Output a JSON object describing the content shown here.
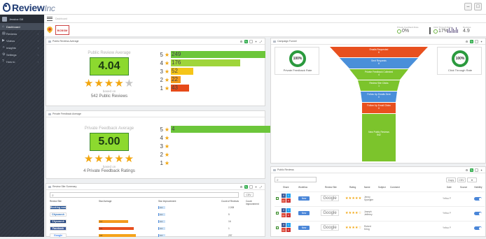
{
  "brand": {
    "name": "Review",
    "suffix": "Inc"
  },
  "sidebar": {
    "user": "Jessica Gill",
    "items": [
      {
        "label": "Dashboard",
        "icon": "home-icon",
        "active": true
      },
      {
        "label": "Reviews",
        "icon": "bar-chart-icon"
      },
      {
        "label": "Videos",
        "icon": "video-icon"
      },
      {
        "label": "Insights",
        "icon": "lightbulb-icon"
      },
      {
        "label": "Settings",
        "icon": "gear-icon"
      },
      {
        "label": "How to",
        "icon": "help-icon"
      }
    ]
  },
  "subbar": {
    "title": "Dashboard"
  },
  "business": {
    "logo_text": "BCBSM",
    "logo_sub": "insurance"
  },
  "kpis": [
    {
      "label": "Private Feedback Rate",
      "value": "0%"
    },
    {
      "label": "Click Through Rate",
      "value": "0%"
    },
    {
      "label": "Pixel Stats",
      "value": "17%"
    },
    {
      "label": "Reviews",
      "value": "4.9"
    }
  ],
  "public_reviews": {
    "panel_title": "Public Reviews Average",
    "heading": "Public Review Average",
    "average": "4.04",
    "stars": 4,
    "based_on": "based on",
    "count_text": "542 Public Reviews",
    "distribution": [
      {
        "star": "5",
        "count": "249",
        "fraction": 1.0,
        "color": "#6cc63a"
      },
      {
        "star": "4",
        "count": "176",
        "fraction": 0.73,
        "color": "#9fd53b"
      },
      {
        "star": "3",
        "count": "52",
        "fraction": 0.24,
        "color": "#f5c518"
      },
      {
        "star": "2",
        "count": "22",
        "fraction": 0.1,
        "color": "#f39a1e"
      },
      {
        "star": "1",
        "count": "43",
        "fraction": 0.19,
        "color": "#e64a19"
      }
    ]
  },
  "private_feedback": {
    "panel_title": "Private Feedback Average",
    "heading": "Private Feedback Average",
    "average": "5.00",
    "stars": 5,
    "based_on": "based on",
    "count_text": "4 Private Feedback Ratings",
    "distribution": [
      {
        "star": "5",
        "count": "4",
        "fraction": 1.0,
        "color": "#6cc63a"
      },
      {
        "star": "4",
        "count": "",
        "fraction": 0,
        "color": "#9fd53b"
      },
      {
        "star": "3",
        "count": "",
        "fraction": 0,
        "color": "#f5c518"
      },
      {
        "star": "2",
        "count": "",
        "fraction": 0,
        "color": "#f39a1e"
      },
      {
        "star": "1",
        "count": "",
        "fraction": 0,
        "color": "#e64a19"
      }
    ]
  },
  "campaign_funnel": {
    "panel_title": "Campaign Funnel",
    "left_donut": {
      "value": "100%",
      "label": "Private Feedback Rate"
    },
    "right_donut": {
      "value": "100%",
      "label": "Click Through Rate"
    },
    "segments": [
      {
        "label": "Emails Requested",
        "value": "6",
        "color": "#e8501f"
      },
      {
        "label": "Sent Requests",
        "value": "6",
        "color": "#4a8fd9"
      },
      {
        "label": "Private Feedback Collected",
        "value": "4",
        "color": "#7cc42c"
      },
      {
        "label": "Review Site Clicks",
        "value": "1",
        "color": "#7cc42c"
      },
      {
        "label": "Follow Up Emails Sent",
        "value": "0",
        "color": "#4a8fd9"
      },
      {
        "label": "Follow Up Email Clicks",
        "value": "0",
        "color": "#e8501f"
      },
      {
        "label": "New Public Reviews",
        "value": "542",
        "color": "#7cc42c"
      }
    ]
  },
  "review_site_summary": {
    "panel_title": "Review Site Summary",
    "buttons": {
      "csv": "CSV"
    },
    "columns": [
      "Review Site",
      "Star Average",
      "Star Improvement",
      "Count of Reviews",
      "Count Improvement"
    ],
    "rows": [
      {
        "site": "Booking.com",
        "site_color": "#1a4a8f",
        "site_text_color": "#ffffff",
        "avg": "",
        "avg_fraction": 0,
        "avg_color": "#f39a1e",
        "impr": "0.0",
        "count": "2,008"
      },
      {
        "site": "Citysearch",
        "site_color": "#ffffff",
        "site_text_color": "#2a6ebd",
        "avg": "",
        "avg_fraction": 0,
        "avg_color": "#f39a1e",
        "impr": "0.0",
        "count": "5"
      },
      {
        "site": "Citysearch",
        "site_color": "#1a3d7a",
        "site_text_color": "#ffffff",
        "avg": "3.0",
        "avg_fraction": 0.6,
        "avg_color": "#f39a1e",
        "impr": "0.0",
        "count": "16"
      },
      {
        "site": "Facebook",
        "site_color": "#3b5998",
        "site_text_color": "#ffffff",
        "avg": "3.6",
        "avg_fraction": 0.72,
        "avg_color": "#e8501f",
        "impr": "0.0",
        "count": "1"
      },
      {
        "site": "Google",
        "site_color": "#ffffff",
        "site_text_color": "#4285f4",
        "avg": "3.8",
        "avg_fraction": 0.75,
        "avg_color": "#f5a31a",
        "impr": "0.0",
        "count": "297"
      }
    ]
  },
  "public_reviews_list": {
    "panel_title": "Public Reviews",
    "buttons": {
      "copy": "Copy",
      "csv": "CSV",
      "filter": "▼"
    },
    "columns": [
      "Share",
      "Workflow",
      "Review Site",
      "Rating",
      "Name",
      "Subject",
      "Comment",
      "Date",
      "Source",
      "Visibility"
    ],
    "rows": [
      {
        "workflow": "New",
        "site": "Google",
        "stars": "★★★★★",
        "name": "Jenny Spangler",
        "date": "Yeltsa P"
      },
      {
        "workflow": "New",
        "site": "Google",
        "stars": "★★★★☆",
        "name": "Joseph Jefferey",
        "date": "Yeltsa P"
      },
      {
        "workflow": "New",
        "site": "Google",
        "stars": "★★★★☆",
        "name": "Robert Kring",
        "date": "Yeltsa P"
      }
    ]
  }
}
